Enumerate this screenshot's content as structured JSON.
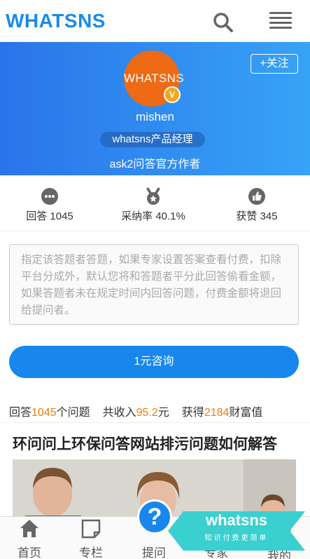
{
  "header": {
    "logo": "WHATSNS",
    "search_icon": "search-icon",
    "menu_icon": "menu-icon"
  },
  "profile": {
    "avatar_text": "WHATSNS",
    "verified_badge": "V",
    "follow_label": "+关注",
    "username": "mishen",
    "role": "whatsns产品经理",
    "intro": "ask2问答官方作者"
  },
  "stats": [
    {
      "icon": "chat-bubble-icon",
      "label": "回答",
      "value": "1045"
    },
    {
      "icon": "medal-icon",
      "label": "采纳率",
      "value": "40.1%"
    },
    {
      "icon": "thumbs-up-icon",
      "label": "获赞",
      "value": "345"
    }
  ],
  "notice": "指定该答题者答题，如果专家设置答案查看付费，扣除平台分成外，默认您将和答题者平分此回答偷看金额，如果答题者未在规定时间内回答问题，付费金额将退回给提问者。",
  "consult_button": "1元咨询",
  "summary": {
    "answers_prefix": "回答",
    "answers_count": "1045",
    "answers_suffix": "个问题",
    "income_prefix": "共收入",
    "income_value": "95.2",
    "income_suffix": "元",
    "wealth_prefix": "获得",
    "wealth_value": "2184",
    "wealth_suffix": "财富值"
  },
  "article": {
    "title": "环问问上环保问答网站排污问题如何解答"
  },
  "tabbar": {
    "items": [
      {
        "label": "首页",
        "icon": "home-icon"
      },
      {
        "label": "专栏",
        "icon": "column-icon"
      },
      {
        "label": "提问",
        "icon": "question-icon"
      },
      {
        "label": "专家",
        "icon": "expert-icon"
      },
      {
        "label": "我的",
        "icon": "user-icon"
      }
    ],
    "ask_symbol": "?"
  },
  "brand_badge": {
    "word": "whatsns",
    "slogan": "知识付费更简单"
  },
  "colors": {
    "brand_blue": "#1a8be8",
    "hero_start": "#2a74ea",
    "hero_end": "#36a3f7",
    "accent_orange": "#f07c00",
    "avatar_orange": "#ef6a14",
    "badge_teal": "#3ad0d0"
  }
}
